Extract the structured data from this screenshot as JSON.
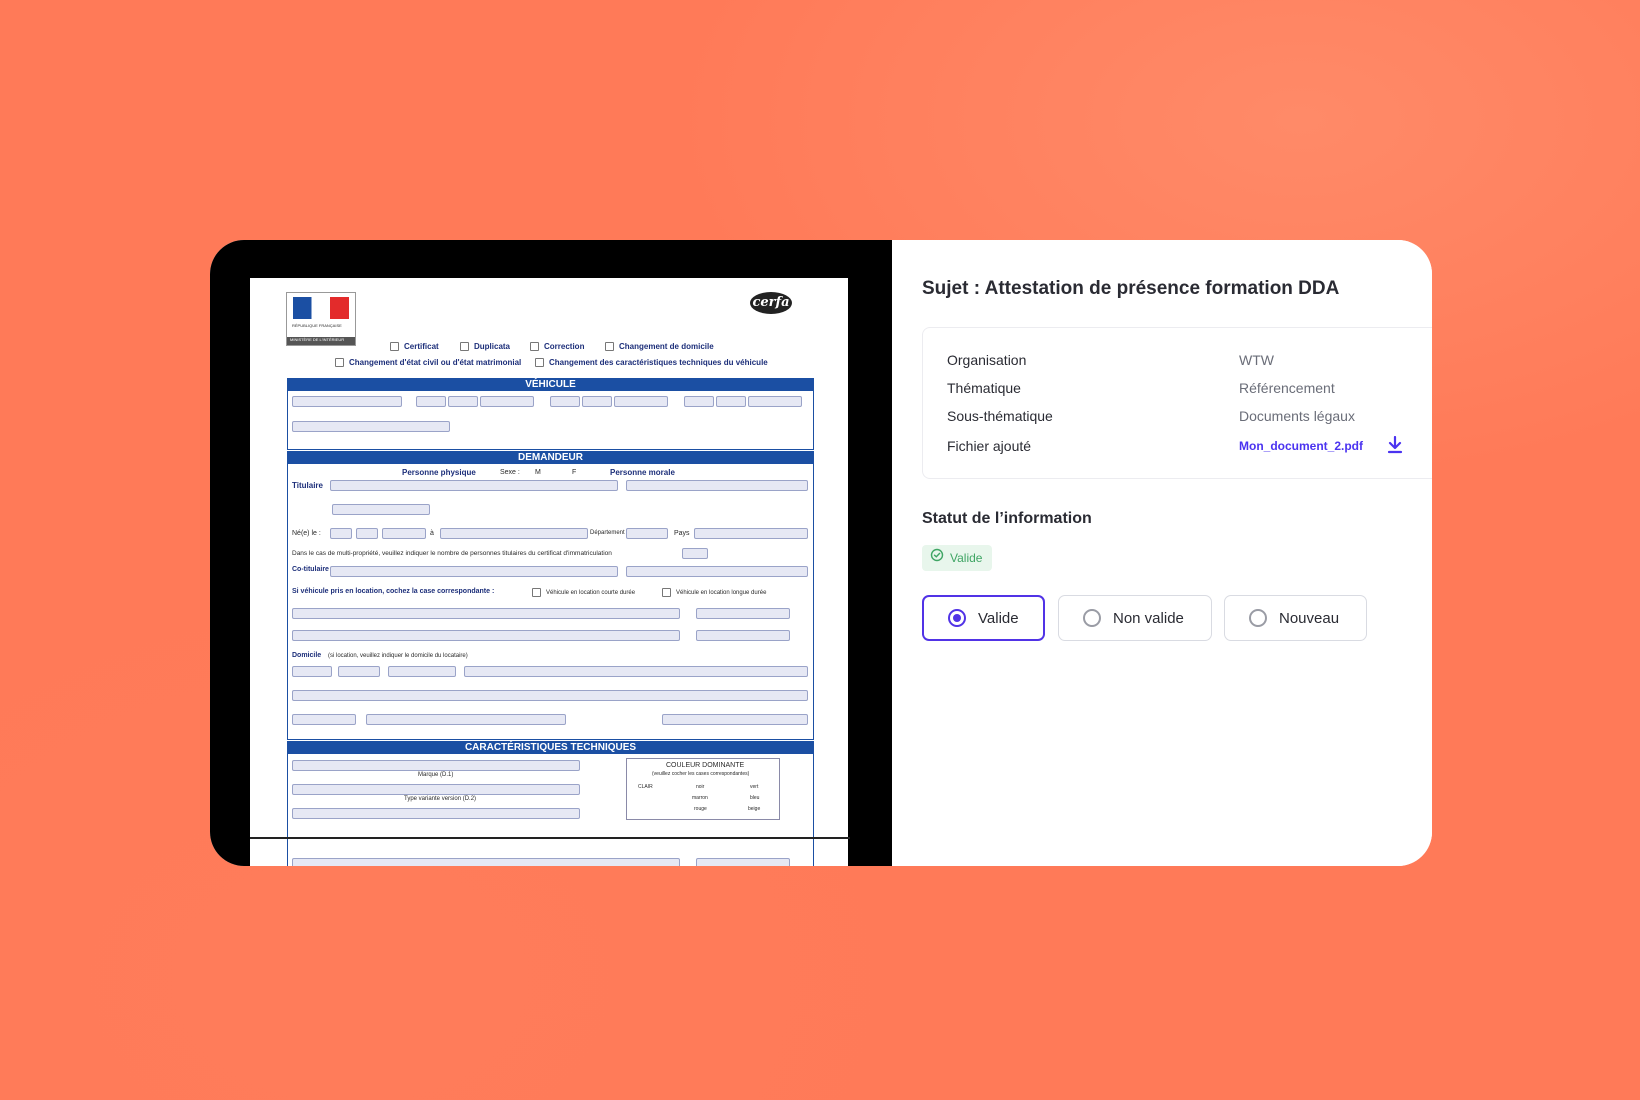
{
  "document_preview": {
    "checkbox_options": [
      "Certificat",
      "Duplicata",
      "Correction",
      "Changement de domicile"
    ],
    "checkbox_options_2": [
      "Changement d'état civil ou d'état matrimonial",
      "Changement des caractéristiques techniques du véhicule"
    ],
    "sections": [
      "VÉHICULE",
      "DEMANDEUR",
      "CARACTÉRISTIQUES TECHNIQUES"
    ],
    "labels": {
      "personne_physique": "Personne physique",
      "sexe": "Sexe :",
      "m": "M",
      "f": "F",
      "personne_morale": "Personne morale",
      "titulaire": "Titulaire",
      "nee_le": "Né(e) le :",
      "a": "à",
      "departement": "Département",
      "pays": "Pays",
      "co_titulaire": "Co-titulaire",
      "location": "Si véhicule pris en location, cochez la case correspondante :",
      "courte": "Véhicule en location courte durée",
      "longue": "Véhicule en location longue durée",
      "domicile": "Domicile",
      "domicile_note": "(si location, veuillez indiquer le domicile du locataire)",
      "multi": "Dans le cas de multi-propriété, veuillez indiquer le nombre de personnes titulaires du certificat d'immatriculation",
      "couleur": "COULEUR DOMINANTE",
      "couleur_note": "(veuillez cocher les cases correspondantes)",
      "marque": "Marque (D.1)",
      "type": "Type variante version (D.2)",
      "clair": "CLAIR",
      "colors": [
        "noir",
        "marron",
        "rouge",
        "vert",
        "bleu",
        "beige"
      ],
      "cerfa": "cerfa",
      "republique": "RÉPUBLIQUE FRANÇAISE",
      "ministere": "MINISTÈRE DE L'INTÉRIEUR"
    }
  },
  "panel": {
    "subject": "Sujet : Attestation de présence formation DDA",
    "info": [
      {
        "label": "Organisation",
        "value": "WTW"
      },
      {
        "label": "Thématique",
        "value": "Référencement"
      },
      {
        "label": "Sous-thématique",
        "value": "Documents légaux"
      }
    ],
    "file_label": "Fichier ajouté",
    "file_name": "Mon_document_2.pdf",
    "status_title": "Statut de l’information",
    "status_badge": "Valide",
    "options": [
      "Valide",
      "Non valide",
      "Nouveau"
    ],
    "selected_option": "Valide",
    "accent_color": "#5133e6",
    "valid_color": "#3fa564"
  }
}
